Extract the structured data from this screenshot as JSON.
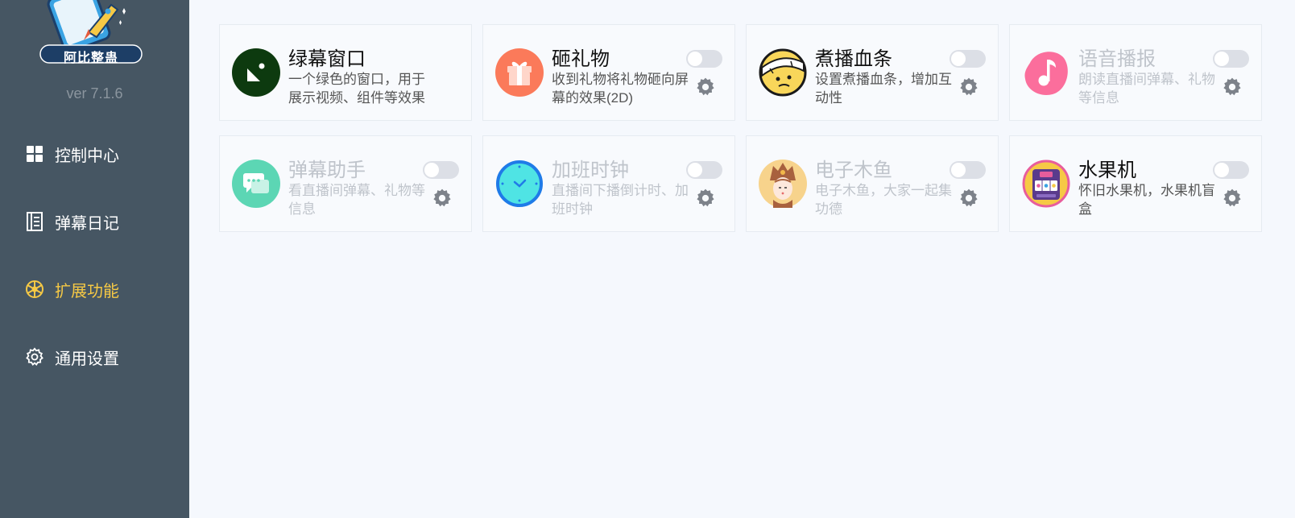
{
  "app": {
    "logo_text": "阿比整蛊",
    "version": "ver 7.1.6"
  },
  "nav": [
    {
      "label": "控制中心",
      "icon": "grid-icon",
      "active": false
    },
    {
      "label": "弹幕日记",
      "icon": "notebook-icon",
      "active": false
    },
    {
      "label": "扩展功能",
      "icon": "wheel-icon",
      "active": true
    },
    {
      "label": "通用设置",
      "icon": "gear-icon",
      "active": false
    }
  ],
  "colors": {
    "sidebar_bg": "#465663",
    "active_nav": "#f6c945",
    "content_bg": "#f5f8fd"
  },
  "plugins": [
    {
      "title": "绿幕窗口",
      "desc": "一个绿色的窗口，用于展示视频、组件等效果",
      "icon": "green-screen-icon",
      "enabled": true,
      "has_toggle": false
    },
    {
      "title": "砸礼物",
      "desc": "收到礼物将礼物砸向屏幕的效果(2D)",
      "icon": "gift-icon",
      "enabled": true,
      "has_toggle": true,
      "toggle_on": false
    },
    {
      "title": "煮播血条",
      "desc": "设置煮播血条，增加互动性",
      "icon": "bandaged-face-icon",
      "enabled": true,
      "has_toggle": true,
      "toggle_on": false
    },
    {
      "title": "语音播报",
      "desc": "朗读直播间弹幕、礼物等信息",
      "icon": "music-note-icon",
      "enabled": false,
      "has_toggle": true,
      "toggle_on": false
    },
    {
      "title": "弹幕助手",
      "desc": "看直播间弹幕、礼物等信息",
      "icon": "chat-bubble-icon",
      "enabled": false,
      "has_toggle": true,
      "toggle_on": false
    },
    {
      "title": "加班时钟",
      "desc": "直播间下播倒计时、加班时钟",
      "icon": "clock-icon",
      "enabled": false,
      "has_toggle": true,
      "toggle_on": false
    },
    {
      "title": "电子木鱼",
      "desc": "电子木鱼，大家一起集功德",
      "icon": "monk-icon",
      "enabled": false,
      "has_toggle": true,
      "toggle_on": false
    },
    {
      "title": "水果机",
      "desc": "怀旧水果机，水果机盲盒",
      "icon": "slot-machine-icon",
      "enabled": true,
      "has_toggle": true,
      "toggle_on": false
    }
  ]
}
